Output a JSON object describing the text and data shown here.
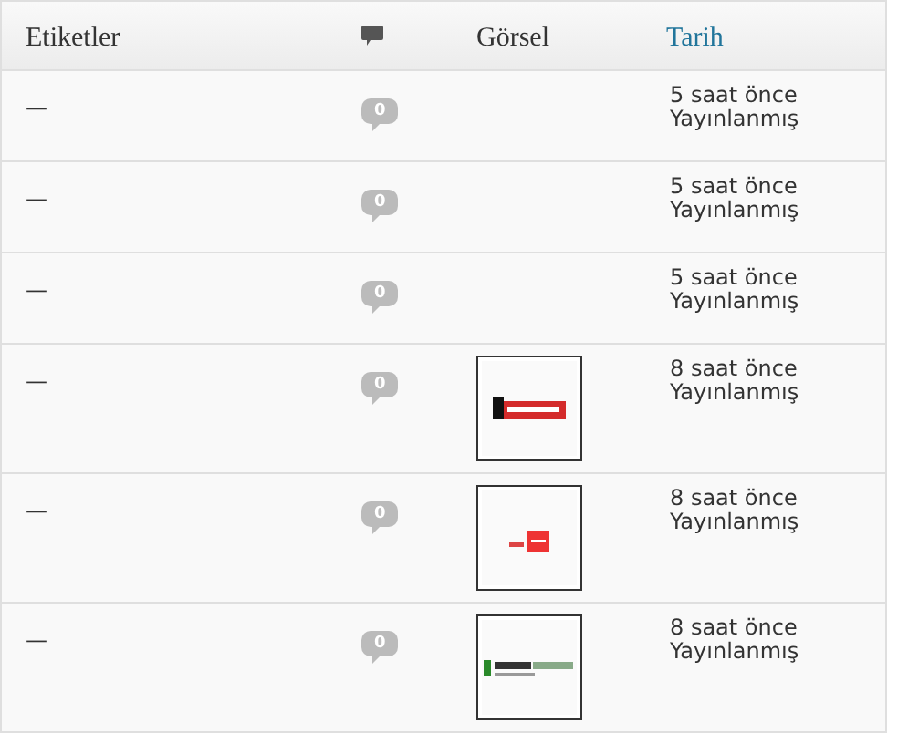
{
  "table": {
    "columns": [
      {
        "label": "Etiketler",
        "kind": "text"
      },
      {
        "kind": "comment-icon"
      },
      {
        "label": "Görsel",
        "kind": "text"
      },
      {
        "label": "Tarih",
        "kind": "link"
      }
    ],
    "rows": [
      {
        "tags": "—",
        "comments": "0",
        "date": "5 saat önce",
        "status": "Yayınlanmış"
      },
      {
        "tags": "—",
        "comments": "0",
        "date": "5 saat önce",
        "status": "Yayınlanmış"
      },
      {
        "tags": "—",
        "comments": "0",
        "date": "5 saat önce",
        "status": "Yayınlanmış"
      },
      {
        "tags": "—",
        "comments": "0",
        "date": "8 saat önce",
        "status": "Yayınlanmış"
      },
      {
        "tags": "—",
        "comments": "0",
        "date": "8 saat önce",
        "status": "Yayınlanmış"
      },
      {
        "tags": "—",
        "comments": "0",
        "date": "8 saat önce",
        "status": "Yayınlanmış"
      }
    ]
  }
}
